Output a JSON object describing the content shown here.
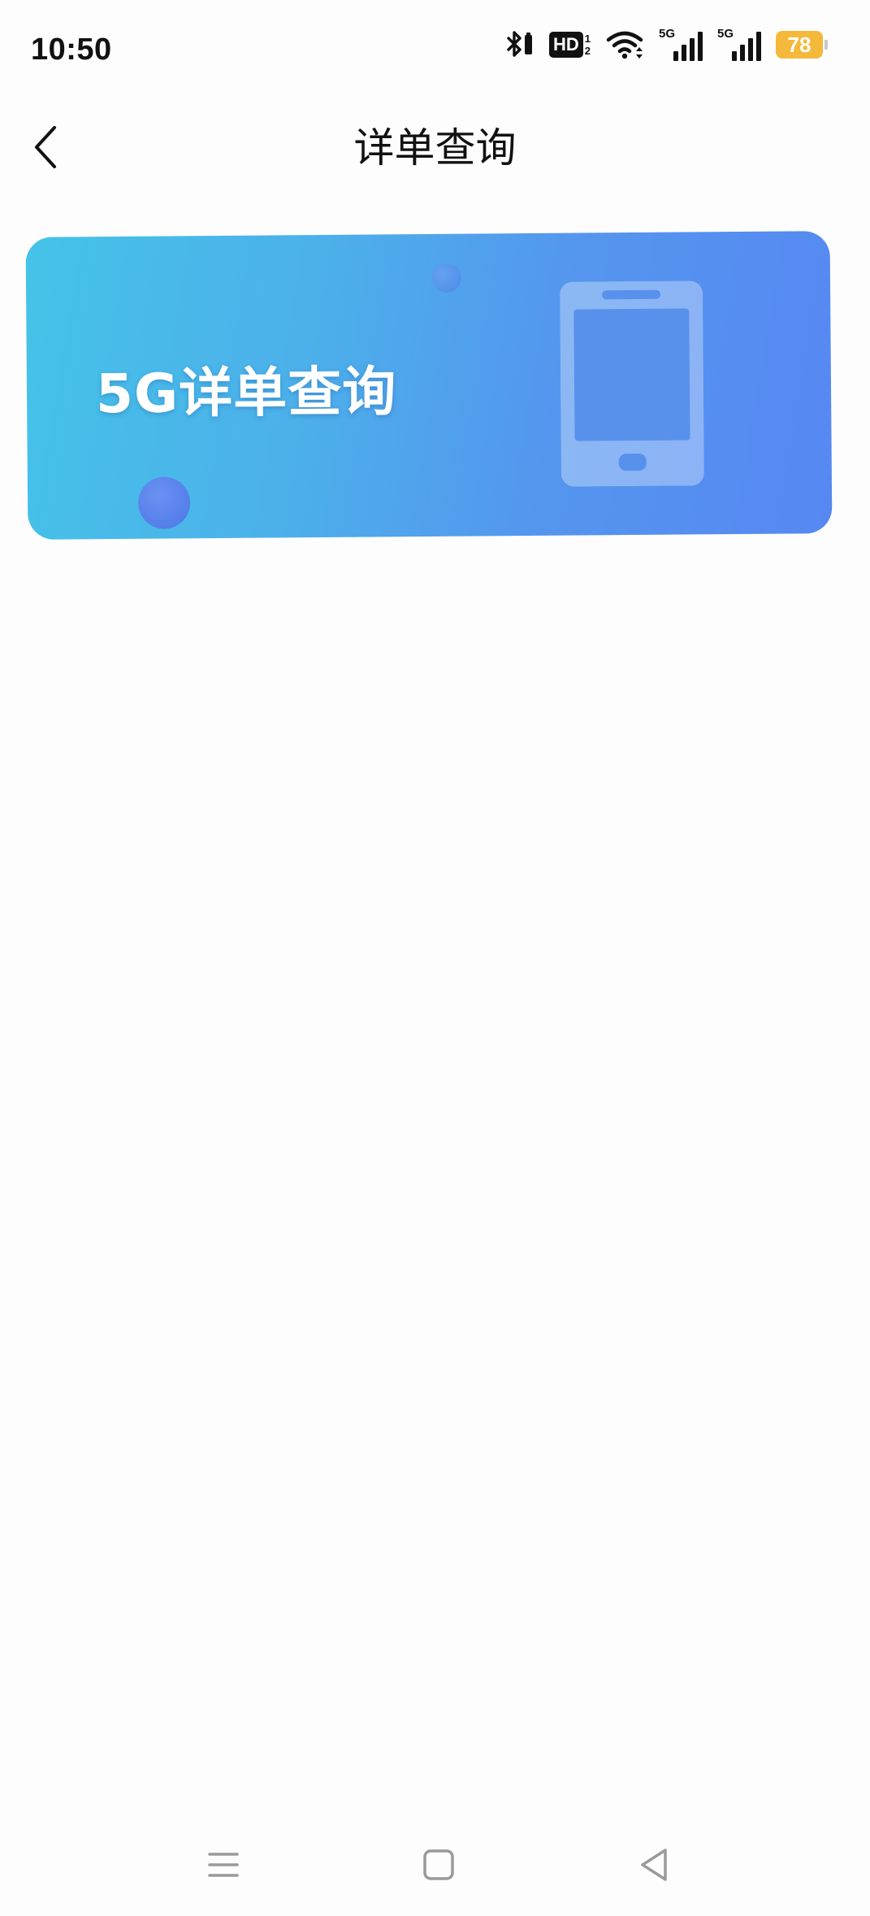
{
  "status_bar": {
    "time": "10:50",
    "hd_label": "HD",
    "hd_sim_top": "1",
    "hd_sim_bottom": "2",
    "signal_1_label": "5G",
    "signal_2_label": "5G",
    "battery_level": "78",
    "battery_color": "#f4b83a",
    "icons": [
      "bluetooth-icon",
      "hd-icon",
      "wifi-icon",
      "signal-icon",
      "signal-icon",
      "battery-icon"
    ]
  },
  "header": {
    "title": "详单查询",
    "back_icon": "chevron-left-icon"
  },
  "banner": {
    "title": "5G详单查询",
    "icon": "phone-icon",
    "gradient_start": "#45c3e8",
    "gradient_end": "#5688f2"
  },
  "nav_bar": {
    "icons": [
      "menu-icon",
      "home-icon",
      "back-triangle-icon"
    ]
  }
}
